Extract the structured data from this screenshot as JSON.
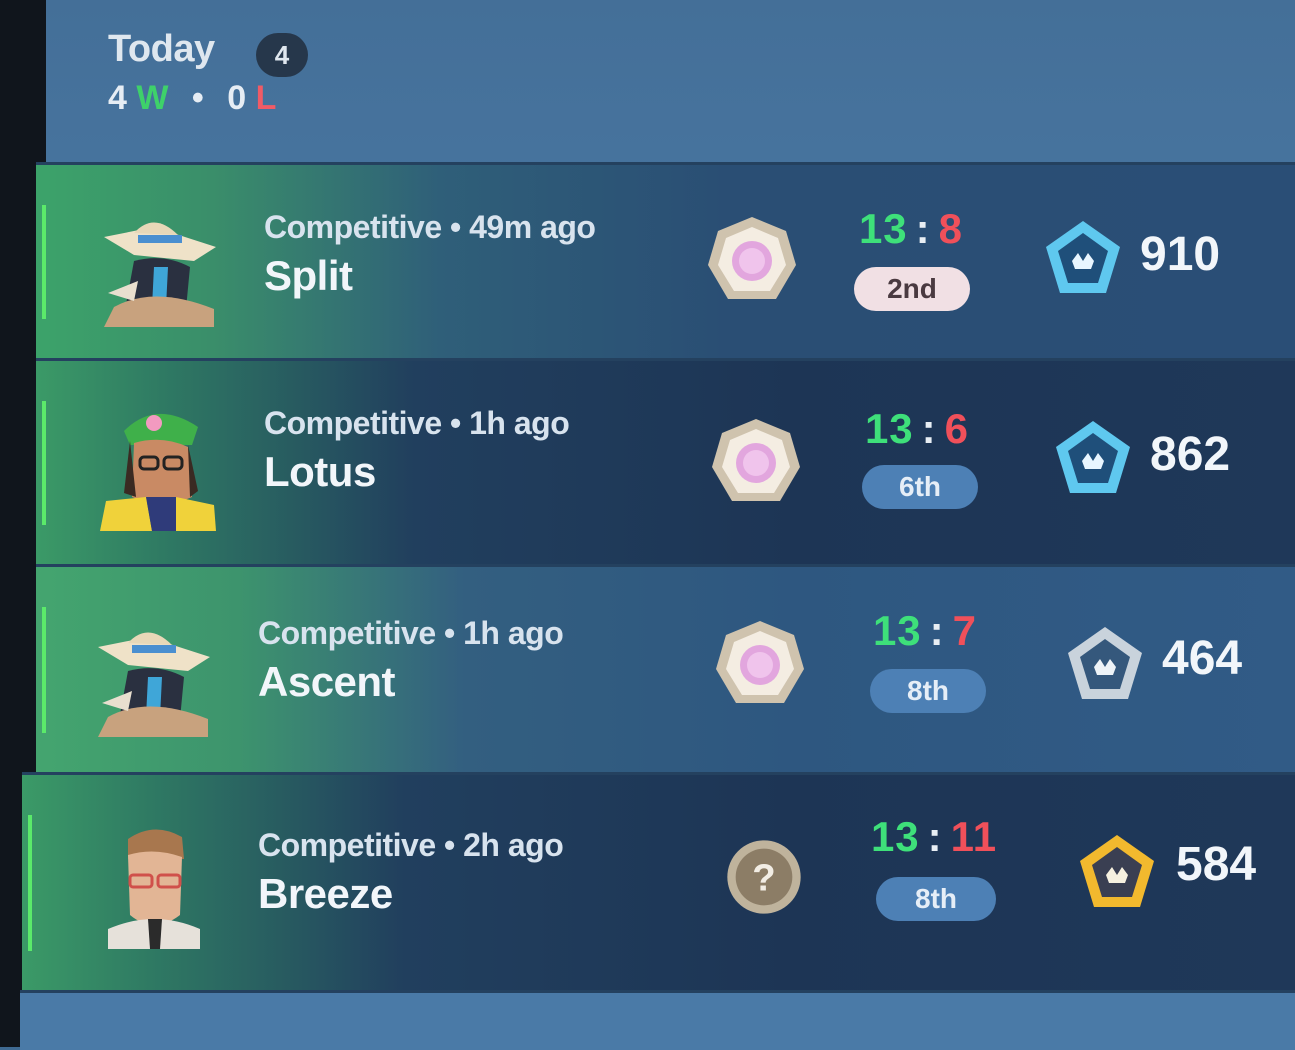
{
  "header": {
    "title": "Today",
    "count": "4",
    "wins_value": "4",
    "wins_suffix": "W",
    "separator": "•",
    "losses_value": "0",
    "losses_suffix": "L"
  },
  "colors": {
    "win_green": "#3ee07a",
    "loss_red": "#f0505a",
    "row_accent": "#5bea6a",
    "mvp_badge": "#f1e0e4",
    "place_badge": "#4d80b5"
  },
  "matches": [
    {
      "agent_icon": "agent-portrait-sage-hat",
      "mode_line": "Competitive • 49m ago",
      "map": "Split",
      "rank_icon": "rank-medallion-icon",
      "score_won": "13",
      "score_sep": ":",
      "score_lost": "8",
      "placement": "2nd",
      "rr_icon": "platinum-rank-icon",
      "rr_value": "910"
    },
    {
      "agent_icon": "agent-portrait-killjoy",
      "mode_line": "Competitive • 1h ago",
      "map": "Lotus",
      "rank_icon": "rank-medallion-icon",
      "score_won": "13",
      "score_sep": ":",
      "score_lost": "6",
      "placement": "6th",
      "rr_icon": "platinum-rank-icon",
      "rr_value": "862"
    },
    {
      "agent_icon": "agent-portrait-sage-hat",
      "mode_line": "Competitive • 1h ago",
      "map": "Ascent",
      "rank_icon": "rank-medallion-icon",
      "score_won": "13",
      "score_sep": ":",
      "score_lost": "7",
      "placement": "8th",
      "rr_icon": "silver-rank-icon",
      "rr_value": "464"
    },
    {
      "agent_icon": "agent-portrait-chamber",
      "mode_line": "Competitive • 2h ago",
      "map": "Breeze",
      "rank_icon": "unknown-rank-icon",
      "rank_glyph": "?",
      "score_won": "13",
      "score_sep": ":",
      "score_lost": "11",
      "placement": "8th",
      "rr_icon": "gold-rank-icon",
      "rr_value": "584"
    }
  ]
}
